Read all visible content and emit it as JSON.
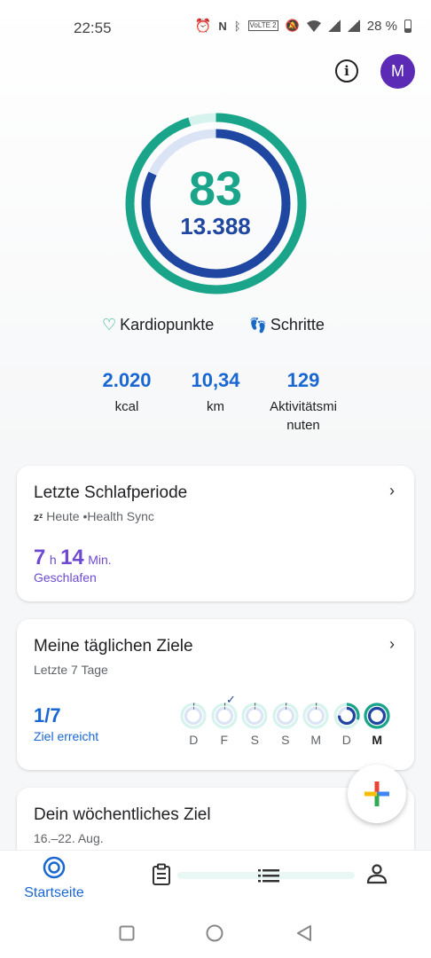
{
  "status_bar": {
    "time": "22:55",
    "battery": "28 %",
    "volte": "VoLTE 2"
  },
  "header": {
    "info_icon": "info-icon",
    "avatar_initial": "M"
  },
  "summary": {
    "heart_points": "83",
    "steps": "13.388",
    "heart_points_progress": 0.95,
    "steps_progress": 0.82,
    "legend_heart": "Kardiopunkte",
    "legend_steps": "Schritte",
    "colors": {
      "heart": "#1aa58a",
      "steps": "#1f46a0"
    }
  },
  "stats": [
    {
      "value": "2.020",
      "label": "kcal"
    },
    {
      "value": "10,34",
      "label": "km"
    },
    {
      "value": "129",
      "label": "Aktivitätsmi nuten"
    }
  ],
  "sleep_card": {
    "title": "Letzte Schlafperiode",
    "source_day": "Heute",
    "source_app": "Health Sync",
    "hours": "7",
    "hours_unit": "h",
    "minutes": "14",
    "minutes_unit": "Min.",
    "label": "Geschlafen"
  },
  "goals_card": {
    "title": "Meine täglichen Ziele",
    "subtitle": "Letzte 7 Tage",
    "value": "1/7",
    "label": "Ziel erreicht",
    "days": [
      {
        "label": "D",
        "heart": 0.0,
        "steps": 0.0
      },
      {
        "label": "F",
        "heart": 0.0,
        "steps": 0.0
      },
      {
        "label": "S",
        "heart": 0.0,
        "steps": 0.0
      },
      {
        "label": "S",
        "heart": 0.0,
        "steps": 0.0
      },
      {
        "label": "M",
        "heart": 0.0,
        "steps": 0.0
      },
      {
        "label": "D",
        "heart": 0.3,
        "steps": 0.75
      },
      {
        "label": "M",
        "heart": 1.0,
        "steps": 1.0
      }
    ]
  },
  "weekly_card": {
    "title": "Dein wöchentliches Ziel",
    "date_range": "16.–22. Aug."
  },
  "bottom_nav": {
    "home_label": "Startseite"
  }
}
